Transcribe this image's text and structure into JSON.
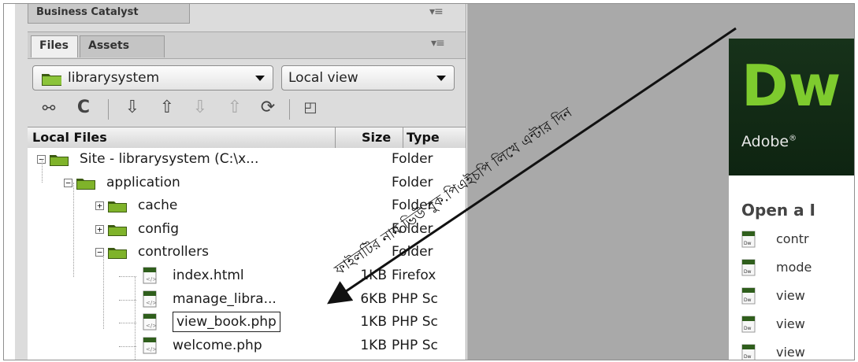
{
  "window": {
    "top_panel_label": "Business Catalyst",
    "tabs": [
      "Files",
      "Assets"
    ]
  },
  "site_select": {
    "value": "librarysystem"
  },
  "view_select": {
    "value": "Local view"
  },
  "toolbar": {
    "icons": [
      "connect-icon",
      "refresh-icon",
      "get-files-icon",
      "put-files-icon",
      "check-out-icon",
      "check-in-icon",
      "synchronize-icon",
      "expand-icon"
    ]
  },
  "columns": {
    "local_files": "Local Files",
    "size": "Size",
    "type": "Type"
  },
  "tree": [
    {
      "name": "Site - librarysystem (C:\\x...",
      "size": "",
      "type": "Folder",
      "kind": "folder",
      "level": 0,
      "toggle": "−"
    },
    {
      "name": "application",
      "size": "",
      "type": "Folder",
      "kind": "folder",
      "level": 1,
      "toggle": "−"
    },
    {
      "name": "cache",
      "size": "",
      "type": "Folder",
      "kind": "folder",
      "level": 2,
      "toggle": "+"
    },
    {
      "name": "config",
      "size": "",
      "type": "Folder",
      "kind": "folder",
      "level": 2,
      "toggle": "+"
    },
    {
      "name": "controllers",
      "size": "",
      "type": "Folder",
      "kind": "folder",
      "level": 2,
      "toggle": "−"
    },
    {
      "name": "index.html",
      "size": "1KB",
      "type": "Firefox",
      "kind": "file",
      "level": 3
    },
    {
      "name": "manage_libra...",
      "size": "6KB",
      "type": "PHP Sc",
      "kind": "file",
      "level": 3
    },
    {
      "name": "view_book.php",
      "size": "1KB",
      "type": "PHP Sc",
      "kind": "file",
      "level": 3,
      "editing": true
    },
    {
      "name": "welcome.php",
      "size": "1KB",
      "type": "PHP Sc",
      "kind": "file",
      "level": 3
    }
  ],
  "welcome": {
    "logo": "Dw",
    "subtitle": "Adobe",
    "open_heading": "Open a I",
    "recent": [
      "contr",
      "mode",
      "view",
      "view",
      "view"
    ]
  },
  "annotation": {
    "text": "ফাইলটির নাম ভিউ বুক.পিএইচপি লিখে এন্টার দিন",
    "color": "#111111"
  },
  "colors": {
    "folder": "#7fb32a",
    "dw_green": "#7ecb2e",
    "dw_bg": "#0e2411"
  }
}
